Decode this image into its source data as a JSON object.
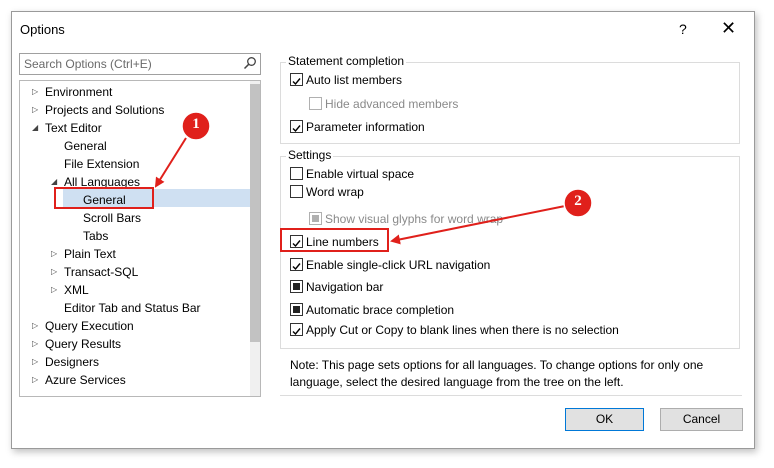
{
  "window": {
    "title": "Options",
    "help": "?",
    "close": "✕"
  },
  "search": {
    "placeholder": "Search Options (Ctrl+E)",
    "icon": "search-icon"
  },
  "tree": [
    {
      "label": "Environment",
      "expander": "collapsed"
    },
    {
      "label": "Projects and Solutions",
      "expander": "collapsed"
    },
    {
      "label": "Text Editor",
      "expander": "expanded"
    },
    {
      "label": "General",
      "expander": "none"
    },
    {
      "label": "File Extension",
      "expander": "none"
    },
    {
      "label": "All Languages",
      "expander": "expanded"
    },
    {
      "label": "General",
      "expander": "none",
      "selected": true
    },
    {
      "label": "Scroll Bars",
      "expander": "none"
    },
    {
      "label": "Tabs",
      "expander": "none"
    },
    {
      "label": "Plain Text",
      "expander": "collapsed"
    },
    {
      "label": "Transact-SQL",
      "expander": "collapsed"
    },
    {
      "label": "XML",
      "expander": "collapsed"
    },
    {
      "label": "Editor Tab and Status Bar",
      "expander": "none"
    },
    {
      "label": "Query Execution",
      "expander": "collapsed"
    },
    {
      "label": "Query Results",
      "expander": "collapsed"
    },
    {
      "label": "Designers",
      "expander": "collapsed"
    },
    {
      "label": "Azure Services",
      "expander": "collapsed"
    }
  ],
  "statement": {
    "title": "Statement completion",
    "auto_list": "Auto list members",
    "hide_adv": "Hide advanced members",
    "param_info": "Parameter information"
  },
  "settings": {
    "title": "Settings",
    "virtual_space": "Enable virtual space",
    "word_wrap": "Word wrap",
    "visual_glyphs": "Show visual glyphs for word wrap",
    "line_numbers": "Line numbers",
    "single_click_url": "Enable single-click URL navigation",
    "nav_bar": "Navigation bar",
    "brace": "Automatic brace completion",
    "cut_copy": "Apply Cut or Copy to blank lines when there is no selection"
  },
  "note": "Note: This page sets options for all languages. To change options for only one language, select the desired language from the tree on the left.",
  "buttons": {
    "ok": "OK",
    "cancel": "Cancel"
  },
  "annotations": {
    "one": "1",
    "two": "2",
    "color": "#e0201b"
  }
}
